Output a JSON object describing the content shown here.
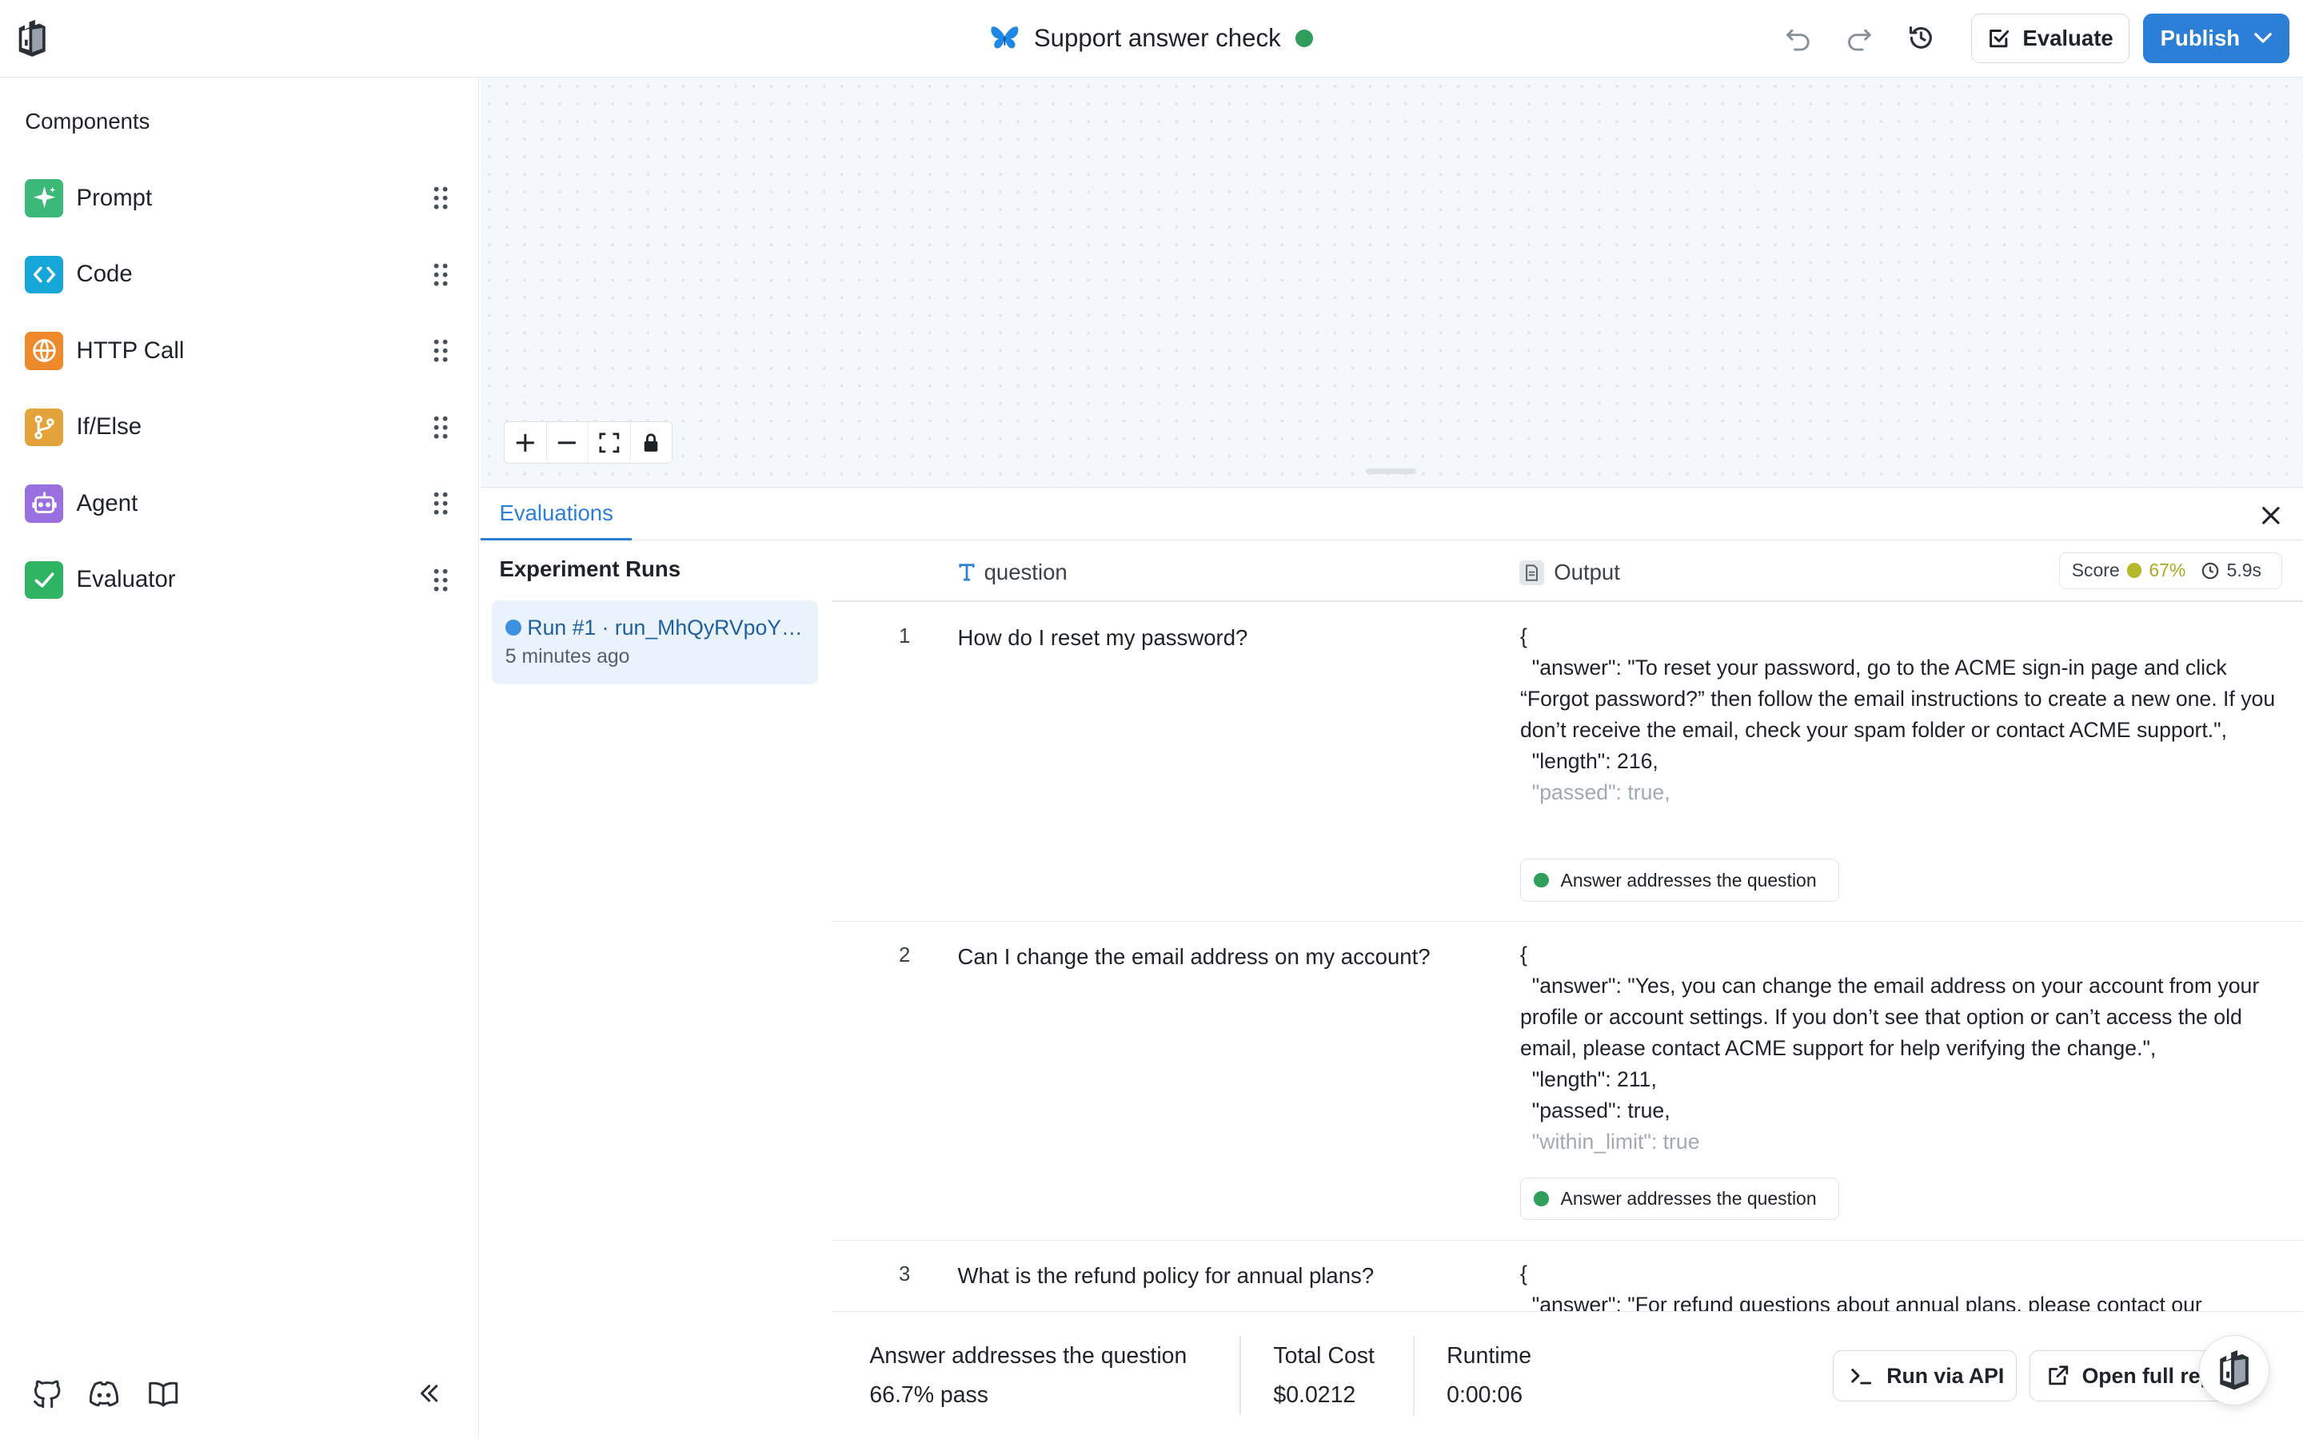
{
  "app": {
    "title": "Support answer check",
    "status_color": "#2f9e5a",
    "logo_icon": "castle-logo",
    "title_icon": "butterfly-icon"
  },
  "toolbar": {
    "undo_icon": "undo-icon",
    "redo_icon": "redo-icon",
    "history_icon": "history-icon",
    "evaluate_label": "Evaluate",
    "publish_label": "Publish",
    "accent_color": "#2b7fd6"
  },
  "sidebar": {
    "title": "Components",
    "items": [
      {
        "label": "Prompt",
        "icon": "sparkle-icon",
        "color": "#3cb878"
      },
      {
        "label": "Code",
        "icon": "code-icon",
        "color": "#16a7d8"
      },
      {
        "label": "HTTP Call",
        "icon": "globe-icon",
        "color": "#ef8a2c"
      },
      {
        "label": "If/Else",
        "icon": "branch-icon",
        "color": "#e3a33a"
      },
      {
        "label": "Agent",
        "icon": "robot-icon",
        "color": "#9a6fe0"
      },
      {
        "label": "Evaluator",
        "icon": "check-icon",
        "color": "#2fb464"
      }
    ],
    "bottom_icons": [
      "github-icon",
      "discord-icon",
      "docs-book-icon",
      "collapse-icon"
    ]
  },
  "canvas": {
    "zoom_controls": [
      "zoom-in-icon",
      "zoom-out-icon",
      "fit-view-icon",
      "lock-icon"
    ]
  },
  "panel": {
    "tab_label": "Evaluations",
    "runs_title": "Experiment Runs",
    "run": {
      "name": "Run #1 · run_MhQyRVpoY…",
      "time": "5 minutes ago"
    },
    "columns": {
      "question": "question",
      "output": "Output"
    },
    "score": {
      "label": "Score",
      "pct": "67%",
      "time": "5.9s"
    }
  },
  "rows": [
    {
      "num": "1",
      "question": "How do I reset my password?",
      "output_lines": "{\n  \"answer\": \"To reset your password, go to the ACME sign-in page and click “Forgot password?” then follow the email instructions to create a new one. If you don’t receive the email, check your spam folder or contact ACME support.\",\n  \"length\": 216,",
      "output_fade": "  \"passed\": true,",
      "badge": "Answer addresses the question"
    },
    {
      "num": "2",
      "question": "Can I change the email address on my account?",
      "output_lines": "{\n  \"answer\": \"Yes, you can change the email address on your account from your profile or account settings. If you don’t see that option or can’t access the old email, please contact ACME support for help verifying the change.\",\n  \"length\": 211,\n  \"passed\": true,",
      "output_fade": "  \"within_limit\": true",
      "badge": "Answer addresses the question"
    },
    {
      "num": "3",
      "question": "What is the refund policy for annual plans?",
      "output_lines": "{\n  \"answer\": \"For refund questions about annual plans, please contact our",
      "output_fade": "",
      "badge": ""
    }
  ],
  "footer": {
    "stats": [
      {
        "label": "Answer addresses the question",
        "value": "66.7% pass"
      },
      {
        "label": "Total Cost",
        "value": "$0.0212"
      },
      {
        "label": "Runtime",
        "value": "0:00:06"
      }
    ],
    "run_api_label": "Run via API",
    "open_report_label": "Open full report"
  }
}
